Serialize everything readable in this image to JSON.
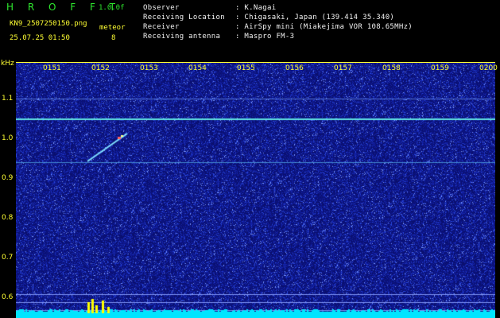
{
  "header": {
    "app_title": "H R O F F T",
    "version": "1.0.0f",
    "filename": "KN9_2507250150.png",
    "mode_label": "meteor",
    "datetime": "25.07.25 01:50",
    "count": "8"
  },
  "station": {
    "observer_label": "Observer",
    "observer_value": ": K.Nagai",
    "location_label": "Receiving Location",
    "location_value": ": Chigasaki, Japan (139.414 35.340)",
    "receiver_label": "Receiver",
    "receiver_value": ": AirSpy mini (Miakejima VOR 108.65MHz)",
    "antenna_label": "Receiving antenna",
    "antenna_value": ": Maspro FM-3"
  },
  "axis": {
    "y_unit": "kHz",
    "y_ticks": [
      "1.1",
      "1.0",
      "0.9",
      "0.8",
      "0.7",
      "0.6"
    ],
    "x_ticks": [
      "0151",
      "0152",
      "0153",
      "0154",
      "0155",
      "0156",
      "0157",
      "0158",
      "0159",
      "0200"
    ]
  },
  "colors": {
    "background": "#0a0f6e",
    "text_yellow": "#ffff33",
    "text_green": "#2ee62e",
    "carrier_line": "#5fe0e0",
    "signal_bar": "#00e5ff"
  }
}
